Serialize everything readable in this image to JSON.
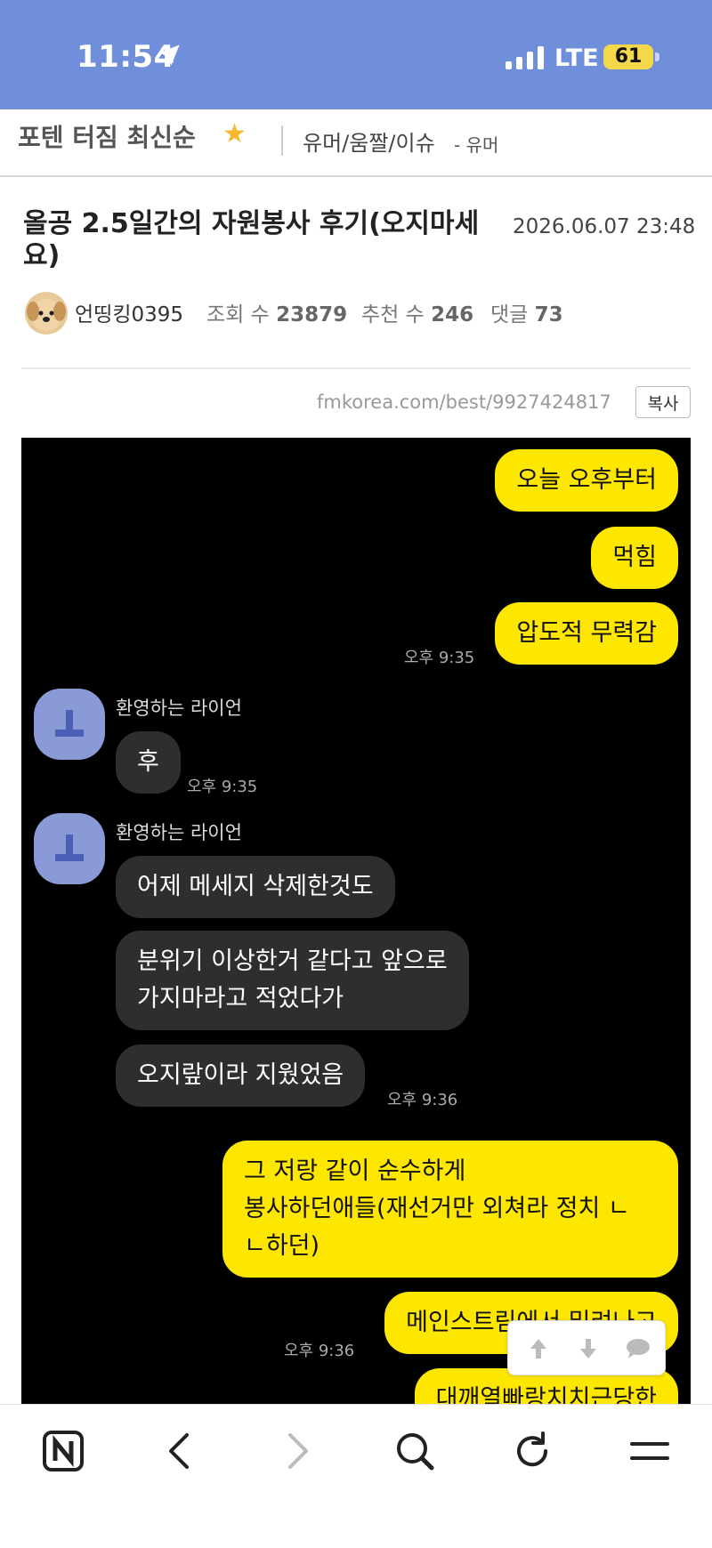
{
  "status": {
    "time": "11:54",
    "network": "LTE",
    "battery": "61"
  },
  "category": {
    "title": "포텐 터짐 최신순",
    "board": "유머/움짤/이슈",
    "sub": "- 유머"
  },
  "article": {
    "title": "올공 2.5일간의 자원봉사 후기(오지마세요)",
    "date": "2026.06.07 23:48",
    "author": "언띵킹0395",
    "views_label": "조회 수",
    "views": "23879",
    "likes_label": "추천 수",
    "likes": "246",
    "comments_label": "댓글",
    "comments": "73",
    "url": "fmkorea.com/best/9927424817",
    "copy_label": "복사"
  },
  "chat": {
    "messages": [
      {
        "text": "오늘 오후부터"
      },
      {
        "text": "먹힘"
      },
      {
        "text": "압도적 무력감",
        "time": "오후 9:35"
      },
      {
        "sender": "환영하는 라이언",
        "text": "후",
        "time": "오후 9:35"
      },
      {
        "sender": "환영하는 라이언",
        "text": "어제 메세지 삭제한것도"
      },
      {
        "text1": "분위기 이상한거 같다고 앞으로",
        "text2": "가지마라고 적었다가"
      },
      {
        "text": "오지랖이라 지웠었음",
        "time": "오후 9:36"
      },
      {
        "text1": "그 저랑 같이 순수하게",
        "text2": "봉사하던애들(재선거만 외쳐라 정치 ㄴ",
        "text3": "ㄴ하던)"
      },
      {
        "text": "메인스트림에서 밀려나고",
        "time": "오후 9:36"
      },
      {
        "text": "대깨열빠랑치치근당한"
      }
    ]
  },
  "icons": [
    "location-arrow-icon",
    "signal-icon",
    "star-icon",
    "person-icon",
    "arrow-up-icon",
    "arrow-down-icon",
    "comment-icon",
    "naver-icon",
    "back-icon",
    "forward-icon",
    "search-icon",
    "refresh-icon",
    "menu-icon"
  ]
}
